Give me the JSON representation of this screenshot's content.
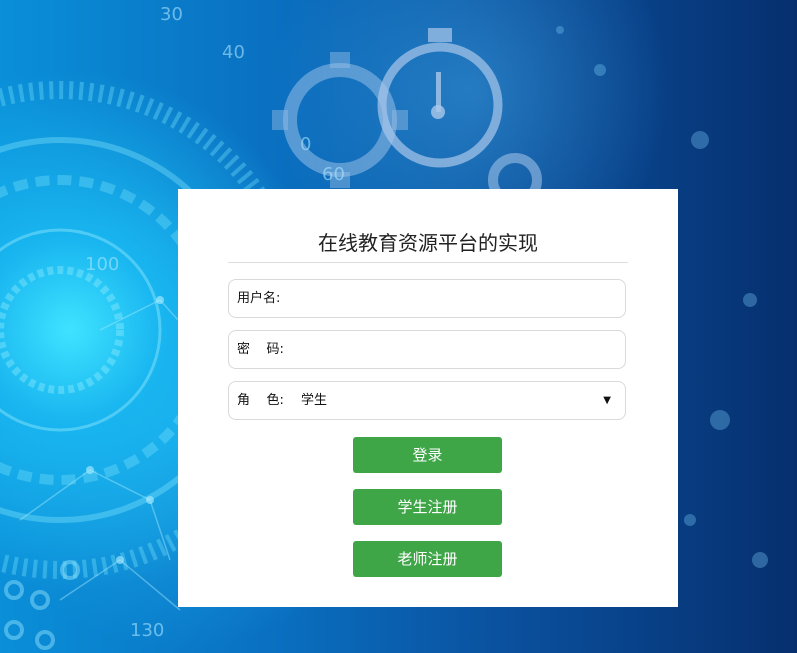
{
  "colors": {
    "button_bg": "#3fa648",
    "panel_bg": "#ffffff",
    "background_primary": "#0a6fc0"
  },
  "login": {
    "title": "在线教育资源平台的实现",
    "username_label": "用户名:",
    "username_value": "",
    "password_label": "密    码:",
    "password_value": "",
    "role_label": "角    色:",
    "role_selected": "学生",
    "role_caret": "▼",
    "login_button": "登录",
    "student_register_button": "学生注册",
    "teacher_register_button": "老师注册"
  },
  "background": {
    "decor_numbers": [
      "30",
      "40",
      "0",
      "60",
      "100",
      "130"
    ]
  }
}
